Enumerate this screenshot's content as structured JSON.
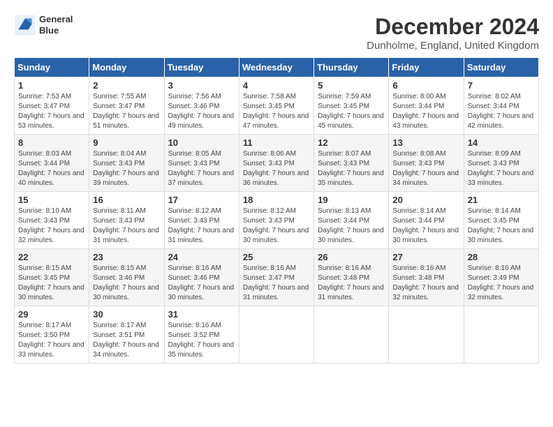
{
  "header": {
    "logo_line1": "General",
    "logo_line2": "Blue",
    "month": "December 2024",
    "location": "Dunholme, England, United Kingdom"
  },
  "weekdays": [
    "Sunday",
    "Monday",
    "Tuesday",
    "Wednesday",
    "Thursday",
    "Friday",
    "Saturday"
  ],
  "weeks": [
    [
      {
        "day": "1",
        "sunrise": "Sunrise: 7:53 AM",
        "sunset": "Sunset: 3:47 PM",
        "daylight": "Daylight: 7 hours and 53 minutes."
      },
      {
        "day": "2",
        "sunrise": "Sunrise: 7:55 AM",
        "sunset": "Sunset: 3:47 PM",
        "daylight": "Daylight: 7 hours and 51 minutes."
      },
      {
        "day": "3",
        "sunrise": "Sunrise: 7:56 AM",
        "sunset": "Sunset: 3:46 PM",
        "daylight": "Daylight: 7 hours and 49 minutes."
      },
      {
        "day": "4",
        "sunrise": "Sunrise: 7:58 AM",
        "sunset": "Sunset: 3:45 PM",
        "daylight": "Daylight: 7 hours and 47 minutes."
      },
      {
        "day": "5",
        "sunrise": "Sunrise: 7:59 AM",
        "sunset": "Sunset: 3:45 PM",
        "daylight": "Daylight: 7 hours and 45 minutes."
      },
      {
        "day": "6",
        "sunrise": "Sunrise: 8:00 AM",
        "sunset": "Sunset: 3:44 PM",
        "daylight": "Daylight: 7 hours and 43 minutes."
      },
      {
        "day": "7",
        "sunrise": "Sunrise: 8:02 AM",
        "sunset": "Sunset: 3:44 PM",
        "daylight": "Daylight: 7 hours and 42 minutes."
      }
    ],
    [
      {
        "day": "8",
        "sunrise": "Sunrise: 8:03 AM",
        "sunset": "Sunset: 3:44 PM",
        "daylight": "Daylight: 7 hours and 40 minutes."
      },
      {
        "day": "9",
        "sunrise": "Sunrise: 8:04 AM",
        "sunset": "Sunset: 3:43 PM",
        "daylight": "Daylight: 7 hours and 39 minutes."
      },
      {
        "day": "10",
        "sunrise": "Sunrise: 8:05 AM",
        "sunset": "Sunset: 3:43 PM",
        "daylight": "Daylight: 7 hours and 37 minutes."
      },
      {
        "day": "11",
        "sunrise": "Sunrise: 8:06 AM",
        "sunset": "Sunset: 3:43 PM",
        "daylight": "Daylight: 7 hours and 36 minutes."
      },
      {
        "day": "12",
        "sunrise": "Sunrise: 8:07 AM",
        "sunset": "Sunset: 3:43 PM",
        "daylight": "Daylight: 7 hours and 35 minutes."
      },
      {
        "day": "13",
        "sunrise": "Sunrise: 8:08 AM",
        "sunset": "Sunset: 3:43 PM",
        "daylight": "Daylight: 7 hours and 34 minutes."
      },
      {
        "day": "14",
        "sunrise": "Sunrise: 8:09 AM",
        "sunset": "Sunset: 3:43 PM",
        "daylight": "Daylight: 7 hours and 33 minutes."
      }
    ],
    [
      {
        "day": "15",
        "sunrise": "Sunrise: 8:10 AM",
        "sunset": "Sunset: 3:43 PM",
        "daylight": "Daylight: 7 hours and 32 minutes."
      },
      {
        "day": "16",
        "sunrise": "Sunrise: 8:11 AM",
        "sunset": "Sunset: 3:43 PM",
        "daylight": "Daylight: 7 hours and 31 minutes."
      },
      {
        "day": "17",
        "sunrise": "Sunrise: 8:12 AM",
        "sunset": "Sunset: 3:43 PM",
        "daylight": "Daylight: 7 hours and 31 minutes."
      },
      {
        "day": "18",
        "sunrise": "Sunrise: 8:12 AM",
        "sunset": "Sunset: 3:43 PM",
        "daylight": "Daylight: 7 hours and 30 minutes."
      },
      {
        "day": "19",
        "sunrise": "Sunrise: 8:13 AM",
        "sunset": "Sunset: 3:44 PM",
        "daylight": "Daylight: 7 hours and 30 minutes."
      },
      {
        "day": "20",
        "sunrise": "Sunrise: 8:14 AM",
        "sunset": "Sunset: 3:44 PM",
        "daylight": "Daylight: 7 hours and 30 minutes."
      },
      {
        "day": "21",
        "sunrise": "Sunrise: 8:14 AM",
        "sunset": "Sunset: 3:45 PM",
        "daylight": "Daylight: 7 hours and 30 minutes."
      }
    ],
    [
      {
        "day": "22",
        "sunrise": "Sunrise: 8:15 AM",
        "sunset": "Sunset: 3:45 PM",
        "daylight": "Daylight: 7 hours and 30 minutes."
      },
      {
        "day": "23",
        "sunrise": "Sunrise: 8:15 AM",
        "sunset": "Sunset: 3:46 PM",
        "daylight": "Daylight: 7 hours and 30 minutes."
      },
      {
        "day": "24",
        "sunrise": "Sunrise: 8:16 AM",
        "sunset": "Sunset: 3:46 PM",
        "daylight": "Daylight: 7 hours and 30 minutes."
      },
      {
        "day": "25",
        "sunrise": "Sunrise: 8:16 AM",
        "sunset": "Sunset: 3:47 PM",
        "daylight": "Daylight: 7 hours and 31 minutes."
      },
      {
        "day": "26",
        "sunrise": "Sunrise: 8:16 AM",
        "sunset": "Sunset: 3:48 PM",
        "daylight": "Daylight: 7 hours and 31 minutes."
      },
      {
        "day": "27",
        "sunrise": "Sunrise: 8:16 AM",
        "sunset": "Sunset: 3:48 PM",
        "daylight": "Daylight: 7 hours and 32 minutes."
      },
      {
        "day": "28",
        "sunrise": "Sunrise: 8:16 AM",
        "sunset": "Sunset: 3:49 PM",
        "daylight": "Daylight: 7 hours and 32 minutes."
      }
    ],
    [
      {
        "day": "29",
        "sunrise": "Sunrise: 8:17 AM",
        "sunset": "Sunset: 3:50 PM",
        "daylight": "Daylight: 7 hours and 33 minutes."
      },
      {
        "day": "30",
        "sunrise": "Sunrise: 8:17 AM",
        "sunset": "Sunset: 3:51 PM",
        "daylight": "Daylight: 7 hours and 34 minutes."
      },
      {
        "day": "31",
        "sunrise": "Sunrise: 8:16 AM",
        "sunset": "Sunset: 3:52 PM",
        "daylight": "Daylight: 7 hours and 35 minutes."
      },
      null,
      null,
      null,
      null
    ]
  ]
}
